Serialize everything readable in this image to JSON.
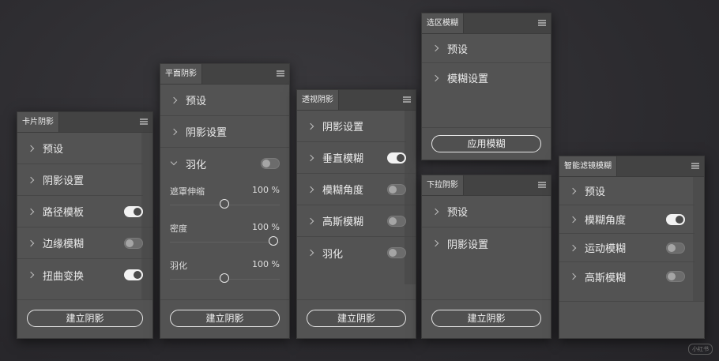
{
  "panels": {
    "card": {
      "tab": "卡片阴影",
      "rows": [
        {
          "label": "预设"
        },
        {
          "label": "阴影设置"
        },
        {
          "label": "路径模板",
          "toggle": true
        },
        {
          "label": "边缘模糊",
          "toggle": false
        },
        {
          "label": "扭曲变换",
          "toggle": true
        }
      ],
      "button": "建立阴影"
    },
    "flat": {
      "tab": "平面阴影",
      "rows": [
        {
          "label": "预设"
        },
        {
          "label": "阴影设置"
        },
        {
          "label": "羽化",
          "toggle": false
        }
      ],
      "sliders": [
        {
          "label": "遮罩伸缩",
          "value": "100 %",
          "position": 0.5
        },
        {
          "label": "密度",
          "value": "100 %",
          "position": 0.95
        },
        {
          "label": "羽化",
          "value": "100 %",
          "position": 0.5
        }
      ],
      "button": "建立阴影"
    },
    "perspective": {
      "tab": "透视阴影",
      "rows": [
        {
          "label": "阴影设置"
        },
        {
          "label": "垂直模糊",
          "toggle": true
        },
        {
          "label": "模糊角度",
          "toggle": false
        },
        {
          "label": "高斯模糊",
          "toggle": false
        },
        {
          "label": "羽化",
          "toggle": false
        }
      ],
      "button": "建立阴影"
    },
    "selection": {
      "tab": "选区模糊",
      "rows": [
        {
          "label": "预设"
        },
        {
          "label": "模糊设置"
        }
      ],
      "button": "应用模糊"
    },
    "dropdown": {
      "tab": "下拉阴影",
      "rows": [
        {
          "label": "预设"
        },
        {
          "label": "阴影设置"
        }
      ],
      "button": "建立阴影"
    },
    "smart": {
      "tab": "智能滤镜模糊",
      "rows": [
        {
          "label": "预设"
        },
        {
          "label": "模糊角度",
          "toggle": true
        },
        {
          "label": "运动模糊",
          "toggle": false
        },
        {
          "label": "高斯模糊",
          "toggle": false
        }
      ]
    }
  },
  "watermark": "小红书",
  "colors": {
    "background": "#2c2b2f",
    "panel": "#535353",
    "tabbar": "#434343",
    "toggle_on": "#f2f2f2",
    "toggle_off": "#6c6c6c"
  },
  "icons": {
    "panel_menu": "hamburger-icon",
    "row_expand": "chevron-right-icon",
    "row_collapse": "chevron-down-icon"
  }
}
